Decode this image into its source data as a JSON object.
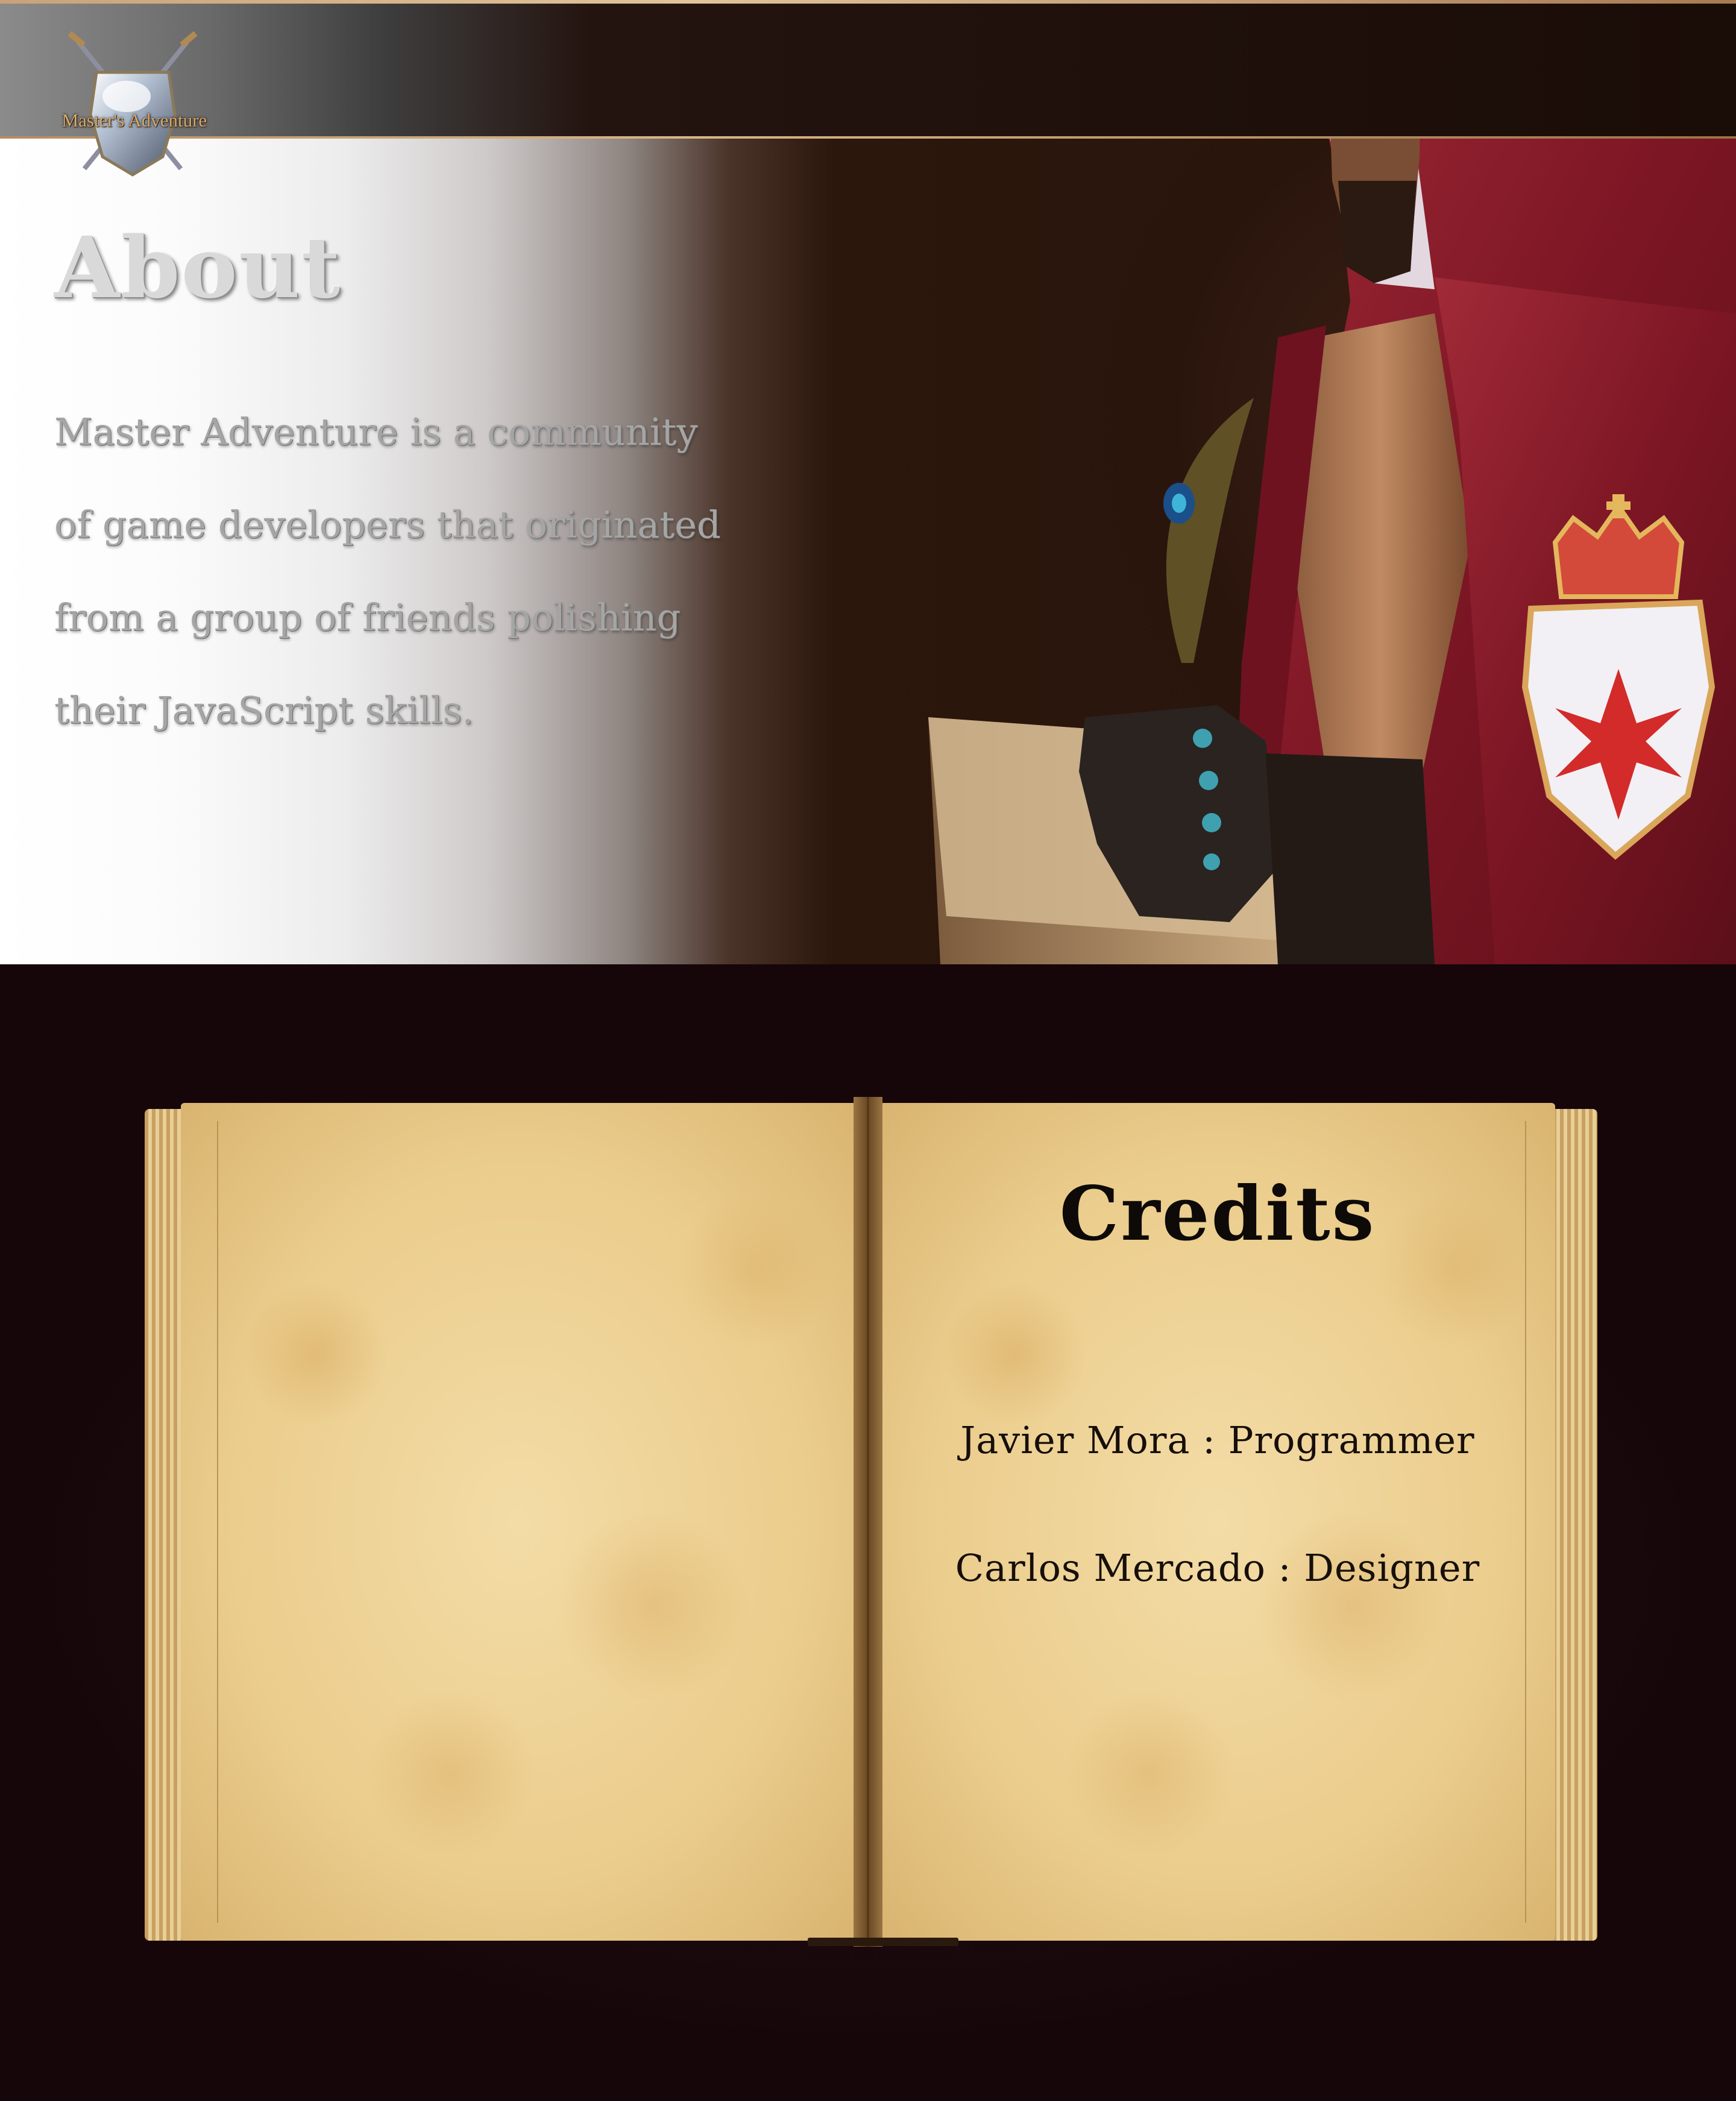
{
  "header": {
    "logo_text": "Master's Adventure"
  },
  "about": {
    "title": "About",
    "lines": [
      "Master Adventure is a community",
      "of game developers that originated",
      "from a group of friends polishing",
      "their JavaScript skills."
    ]
  },
  "credits": {
    "title": "Credits",
    "entries": [
      "Javier Mora : Programmer",
      "Carlos Mercado : Designer"
    ]
  },
  "colors": {
    "topbar_accent": "#d8b688",
    "page_background": "#1a070b",
    "parchment": "#ebcd8d",
    "cloak": "#8c1e2c"
  }
}
